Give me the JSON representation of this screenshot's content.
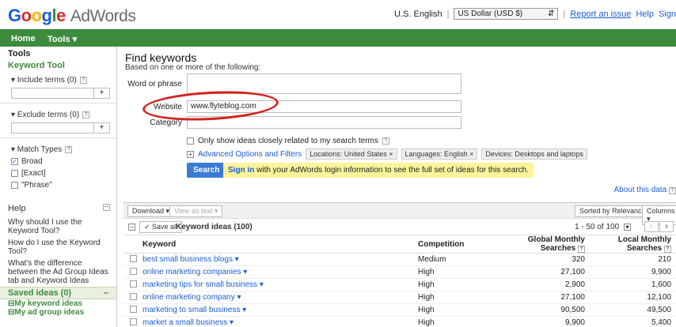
{
  "header": {
    "logo_text": "Google",
    "product": "AdWords",
    "language": "U.S. English",
    "currency": "US Dollar (USD $)",
    "report_issue": "Report an issue",
    "help": "Help",
    "sign_in": "Sign"
  },
  "nav": {
    "home": "Home",
    "tools": "Tools ▾"
  },
  "sidebar": {
    "tools_title": "Tools",
    "keyword_tool": "Keyword Tool",
    "include_terms": "▾ Include terms (0)",
    "exclude_terms": "▾ Exclude terms (0)",
    "add_symbol": "+",
    "match_types": "▾ Match Types",
    "match_broad": "Broad",
    "match_exact": "[Exact]",
    "match_phrase": "\"Phrase\"",
    "help_title": "Help",
    "help_q1": "Why should I use the Keyword Tool?",
    "help_q2": "How do I use the Keyword Tool?",
    "help_q3": "What's the difference between the Ad Group Ideas tab and Keyword Ideas",
    "saved_ideas": "Saved ideas (0)",
    "my_keyword_ideas": "My keyword ideas",
    "my_ad_group_ideas": "My ad group ideas"
  },
  "find": {
    "title": "Find keywords",
    "subtitle": "Based on one or more of the following:",
    "word_label": "Word or phrase",
    "website_label": "Website",
    "website_value": "www.flyteblog.com",
    "category_label": "Category",
    "only_show": "Only show ideas closely related to my search terms",
    "advanced": "Advanced Options and Filters",
    "location_chip": "Locations: United States ×",
    "language_chip": "Languages: English ×",
    "devices_chip": "Devices: Desktops and laptops",
    "search_button": "Search",
    "signin_link": "Sign in",
    "signin_text": "with your AdWords login information to see the full set of ideas for this search.",
    "about_data": "About this data"
  },
  "results": {
    "download": "Download ▾",
    "view_as_text": "View as text ▾",
    "sorted_by": "Sorted by Relevance ▾",
    "columns": "Columns ▾",
    "save_all": "✓ Save all",
    "ideas_header": "Keyword ideas (100)",
    "pager": "1 - 50 of 100",
    "col_keyword": "Keyword",
    "col_competition": "Competition",
    "col_global": "Global Monthly Searches",
    "col_local": "Local Monthly Searches",
    "rows": [
      {
        "keyword": "best small business blogs ▾",
        "competition": "Medium",
        "global": "320",
        "local": "210"
      },
      {
        "keyword": "online marketing companies ▾",
        "competition": "High",
        "global": "27,100",
        "local": "9,900"
      },
      {
        "keyword": "marketing tips for small business ▾",
        "competition": "High",
        "global": "2,900",
        "local": "1,600"
      },
      {
        "keyword": "online marketing company ▾",
        "competition": "High",
        "global": "27,100",
        "local": "12,100"
      },
      {
        "keyword": "marketing to small business ▾",
        "competition": "High",
        "global": "90,500",
        "local": "49,500"
      },
      {
        "keyword": "market a small business ▾",
        "competition": "High",
        "global": "9,900",
        "local": "5,400"
      }
    ]
  }
}
